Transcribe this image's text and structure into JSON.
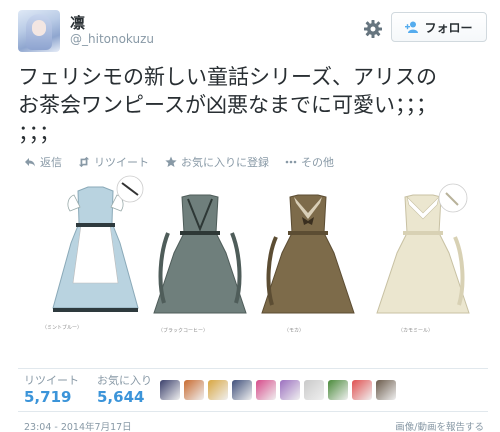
{
  "user": {
    "display_name": "凛",
    "screen_name": "@_hitonokuzu"
  },
  "follow_button": {
    "label": "フォロー"
  },
  "tweet": {
    "line1": "フェリシモの新しい童話シリーズ、アリスの",
    "line2": "お茶会ワンピースが凶悪なまでに可愛い；；；",
    "line3": "；；；"
  },
  "actions": {
    "reply": "返信",
    "retweet": "リツイート",
    "favorite": "お気に入りに登録",
    "more": "その他"
  },
  "photo": {
    "labels": [
      "（ミントブルー）",
      "（ブラックコーヒー）",
      "（モカ）",
      "（カモミール）"
    ],
    "dress_colors": [
      "#b9d3e0",
      "#6f7f7c",
      "#7d6b4a",
      "#ebe6cf"
    ]
  },
  "stats": {
    "retweet_label": "リツイート",
    "retweet_count": "5,719",
    "favorite_label": "お気に入り",
    "favorite_count": "5,644"
  },
  "favoriters": {
    "avatar_colors": [
      "#3a3f6b",
      "#c86a2f",
      "#d8a640",
      "#3f4f7a",
      "#d64a8a",
      "#9b6fbf",
      "#c9c9c9",
      "#4a8a3a",
      "#e05050",
      "#6a5a4a"
    ]
  },
  "footer": {
    "timestamp": "23:04 - 2014年7月17日",
    "report": "画像/動画を報告する"
  }
}
